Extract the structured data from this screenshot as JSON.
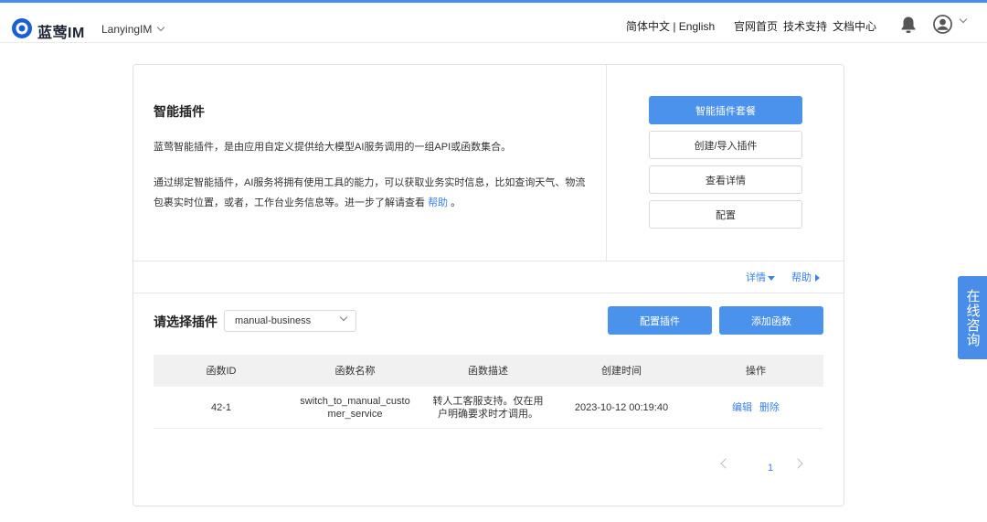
{
  "header": {
    "logo_text": "蓝莺IM",
    "app_name": "LanyingIM",
    "lang": "简体中文 | English",
    "nav": [
      "官网首页",
      "技术支持",
      "文档中心"
    ]
  },
  "intro": {
    "title": "智能插件",
    "p1": "蓝莺智能插件，是由应用自定义提供给大模型AI服务调用的一组API或函数集合。",
    "p2": "通过绑定智能插件，AI服务将拥有使用工具的能力，可以获取业务实时信息，比如查询天气、物流包裹实时位置，或者，工作台业务信息等。进一步了解请查看",
    "help_link": "帮助",
    "end": " 。"
  },
  "side_buttons": {
    "package": "智能插件套餐",
    "create": "创建/导入插件",
    "details": "查看详情",
    "config": "配置"
  },
  "mini_links": {
    "details": "详情",
    "help": "帮助"
  },
  "plugin_select": {
    "label": "请选择插件",
    "value": "manual-business"
  },
  "actions": {
    "config_plugin": "配置插件",
    "add_function": "添加函数"
  },
  "table": {
    "headers": [
      "函数ID",
      "函数名称",
      "函数描述",
      "创建时间",
      "操作"
    ],
    "rows": [
      {
        "id": "42-1",
        "name": "switch_to_manual_customer_service",
        "desc": "转人工客服支持。仅在用户明确要求时才调用。",
        "created": "2023-10-12 00:19:40",
        "edit": "编辑",
        "delete": "删除"
      }
    ]
  },
  "pagination": {
    "current": "1"
  },
  "float_button": "在线咨询",
  "colors": {
    "accent": "#4a92ec",
    "link": "#3a82e6"
  }
}
